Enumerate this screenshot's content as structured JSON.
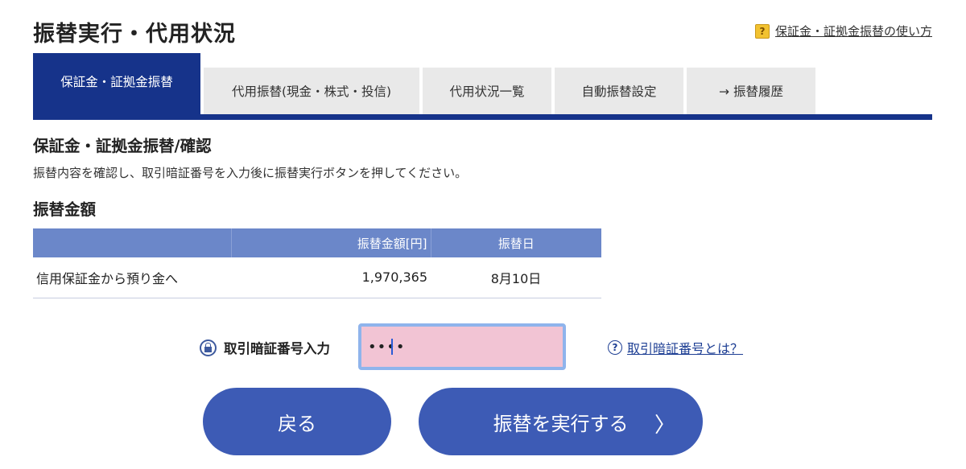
{
  "page": {
    "title": "振替実行・代用状況",
    "help_link": "保証金・証拠金振替の使い方"
  },
  "tabs": [
    {
      "label": "保証金・証拠金振替",
      "active": true
    },
    {
      "label": "代用振替(現金・株式・投信)",
      "active": false
    },
    {
      "label": "代用状況一覧",
      "active": false
    },
    {
      "label": "自動振替設定",
      "active": false
    },
    {
      "label": "→ 振替履歴",
      "active": false
    }
  ],
  "section": {
    "title": "保証金・証拠金振替/確認",
    "description": "振替内容を確認し、取引暗証番号を入力後に振替実行ボタンを押してください。",
    "amount_title": "振替金額"
  },
  "table": {
    "headers": [
      "",
      "振替金額[円]",
      "振替日"
    ],
    "rows": [
      [
        "信用保証金から預り金へ",
        "1,970,365",
        "8月10日"
      ]
    ]
  },
  "password": {
    "label": "取引暗証番号入力",
    "value": "••••",
    "help_link": "取引暗証番号とは？"
  },
  "buttons": {
    "back": "戻る",
    "execute": "振替を実行する",
    "execute_chevron": "〉"
  },
  "colors": {
    "primary": "#16338a",
    "table_header": "#6b87c9",
    "button": "#3d5bb5",
    "input_bg": "#f2c4d4",
    "input_border": "#8fb4ec"
  }
}
